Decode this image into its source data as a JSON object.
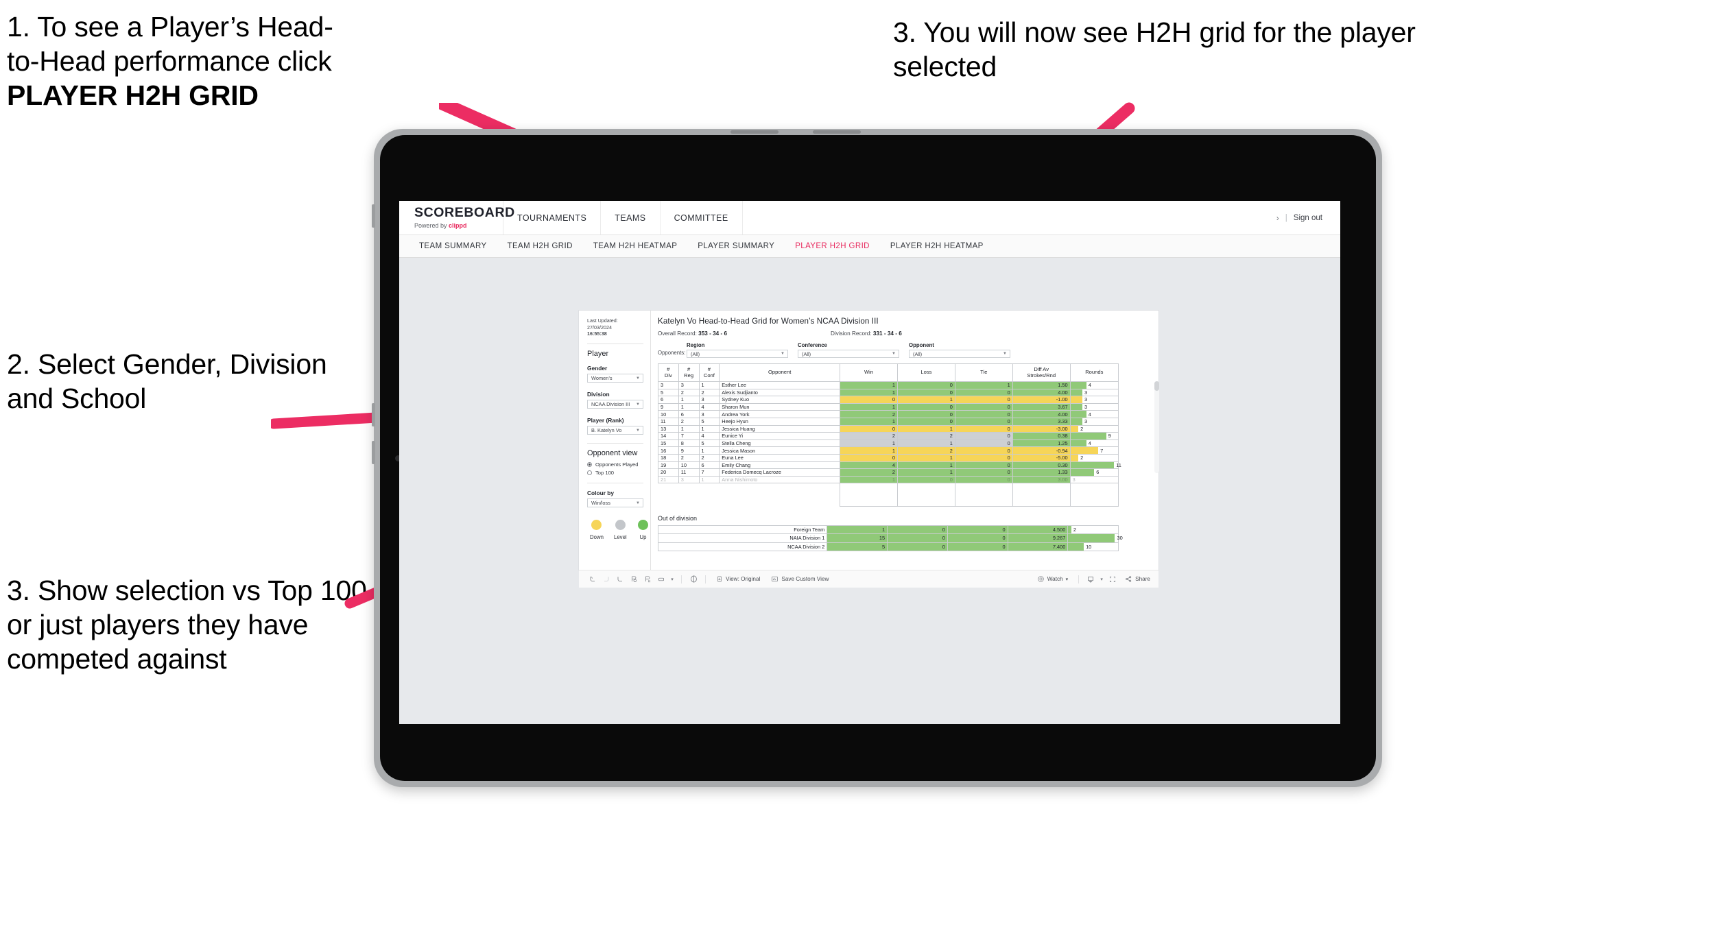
{
  "annotations": [
    {
      "id": "annot-1",
      "line1": "1. To see a Player’s Head-",
      "line2": "to-Head performance click",
      "bold": "PLAYER H2H GRID"
    },
    {
      "id": "annot-2",
      "text": "2. Select Gender, Division and School"
    },
    {
      "id": "annot-3",
      "text": "3. Show selection vs Top 100 or just players they have competed against"
    },
    {
      "id": "annot-4",
      "text": "3. You will now see H2H grid for the player selected"
    }
  ],
  "app": {
    "brand": {
      "title": "SCOREBOARD",
      "powered_prefix": "Powered by ",
      "powered_brand": "clippd"
    },
    "top_nav": [
      "TOURNAMENTS",
      "TEAMS",
      "COMMITTEE"
    ],
    "account": {
      "chevron": "›",
      "separator": "|",
      "sign_out": "Sign out"
    },
    "sub_nav": [
      {
        "label": "TEAM SUMMARY",
        "active": false
      },
      {
        "label": "TEAM H2H GRID",
        "active": false
      },
      {
        "label": "TEAM H2H HEATMAP",
        "active": false
      },
      {
        "label": "PLAYER SUMMARY",
        "active": false
      },
      {
        "label": "PLAYER H2H GRID",
        "active": true
      },
      {
        "label": "PLAYER H2H HEATMAP",
        "active": false
      }
    ],
    "accent_color": "#e8285d"
  },
  "panel": {
    "last_updated_label": "Last Updated: 27/03/2024",
    "last_updated_time": "16:55:38",
    "section_player": "Player",
    "gender": {
      "label": "Gender",
      "value": "Women’s"
    },
    "division": {
      "label": "Division",
      "value": "NCAA Division III"
    },
    "player_rank": {
      "label": "Player (Rank)",
      "value": "B. Katelyn Vo"
    },
    "opponent_view": {
      "label": "Opponent view",
      "options": [
        {
          "label": "Opponents Played",
          "selected": true
        },
        {
          "label": "Top 100",
          "selected": false
        }
      ]
    },
    "colour_by": {
      "label": "Colour by",
      "value": "Win/loss"
    },
    "legend": [
      {
        "label": "Down",
        "color": "#f6d558"
      },
      {
        "label": "Level",
        "color": "#c3c6ca"
      },
      {
        "label": "Up",
        "color": "#6ec15a"
      }
    ]
  },
  "main": {
    "title": "Katelyn Vo Head-to-Head Grid for Women’s NCAA Division III",
    "overall_record_label": "Overall Record:",
    "overall_record_value": "353 -  34 - 6",
    "division_record_label": "Division Record:",
    "division_record_value": "331 -  34 - 6",
    "opponents_label": "Opponents:",
    "filters": [
      {
        "label": "Region",
        "value": "(All)"
      },
      {
        "label": "Conference",
        "value": "(All)"
      },
      {
        "label": "Opponent",
        "value": "(All)"
      }
    ],
    "table_headers": [
      "#\nDiv",
      "#\nReg",
      "#\nConf",
      "Opponent",
      "Win",
      "Loss",
      "Tie",
      "Diff Av\nStrokes/Rnd",
      "Rounds"
    ],
    "header_div_l1": "#",
    "header_div_l2": "Div",
    "header_reg_l1": "#",
    "header_reg_l2": "Reg",
    "header_conf_l1": "#",
    "header_conf_l2": "Conf",
    "header_opponent": "Opponent",
    "header_win": "Win",
    "header_loss": "Loss",
    "header_tie": "Tie",
    "header_diff_l1": "Diff Av",
    "header_diff_l2": "Strokes/Rnd",
    "header_rounds": "Rounds",
    "out_of_division_title": "Out of division"
  },
  "chart_data": {
    "type": "table",
    "title": "Katelyn Vo Head-to-Head Grid for Women’s NCAA Division III",
    "columns": [
      "# Div",
      "# Reg",
      "# Conf",
      "Opponent",
      "Win",
      "Loss",
      "Tie",
      "Diff Av Strokes/Rnd",
      "Rounds"
    ],
    "rows": [
      {
        "div": "3",
        "reg": "3",
        "conf": "1",
        "opponent": "Esther Lee",
        "win": "1",
        "loss": "0",
        "tie": "1",
        "diff": "1.50",
        "rounds": "4",
        "state": "up"
      },
      {
        "div": "5",
        "reg": "2",
        "conf": "2",
        "opponent": "Alexis Sudjianto",
        "win": "1",
        "loss": "0",
        "tie": "0",
        "diff": "4.00",
        "rounds": "3",
        "state": "up"
      },
      {
        "div": "6",
        "reg": "1",
        "conf": "3",
        "opponent": "Sydney Kuo",
        "win": "0",
        "loss": "1",
        "tie": "0",
        "diff": "-1.00",
        "rounds": "3",
        "state": "down"
      },
      {
        "div": "9",
        "reg": "1",
        "conf": "4",
        "opponent": "Sharon Mun",
        "win": "1",
        "loss": "0",
        "tie": "0",
        "diff": "3.67",
        "rounds": "3",
        "state": "up"
      },
      {
        "div": "10",
        "reg": "6",
        "conf": "3",
        "opponent": "Andrea York",
        "win": "2",
        "loss": "0",
        "tie": "0",
        "diff": "4.00",
        "rounds": "4",
        "state": "up"
      },
      {
        "div": "11",
        "reg": "2",
        "conf": "5",
        "opponent": "Heejo Hyun",
        "win": "1",
        "loss": "0",
        "tie": "0",
        "diff": "3.33",
        "rounds": "3",
        "state": "up"
      },
      {
        "div": "13",
        "reg": "1",
        "conf": "1",
        "opponent": "Jessica Huang",
        "win": "0",
        "loss": "1",
        "tie": "0",
        "diff": "-3.00",
        "rounds": "2",
        "state": "down"
      },
      {
        "div": "14",
        "reg": "7",
        "conf": "4",
        "opponent": "Eunice Yi",
        "win": "2",
        "loss": "2",
        "tie": "0",
        "diff": "0.38",
        "rounds": "9",
        "state": "level",
        "diff_state": "up"
      },
      {
        "div": "15",
        "reg": "8",
        "conf": "5",
        "opponent": "Stella Cheng",
        "win": "1",
        "loss": "1",
        "tie": "0",
        "diff": "1.25",
        "rounds": "4",
        "state": "level",
        "diff_state": "up"
      },
      {
        "div": "16",
        "reg": "9",
        "conf": "1",
        "opponent": "Jessica Mason",
        "win": "1",
        "loss": "2",
        "tie": "0",
        "diff": "-0.94",
        "rounds": "7",
        "state": "down"
      },
      {
        "div": "18",
        "reg": "2",
        "conf": "2",
        "opponent": "Euna Lee",
        "win": "0",
        "loss": "1",
        "tie": "0",
        "diff": "-5.00",
        "rounds": "2",
        "state": "down"
      },
      {
        "div": "19",
        "reg": "10",
        "conf": "6",
        "opponent": "Emily Chang",
        "win": "4",
        "loss": "1",
        "tie": "0",
        "diff": "0.30",
        "rounds": "11",
        "state": "up"
      },
      {
        "div": "20",
        "reg": "11",
        "conf": "7",
        "opponent": "Federica Domecq Lacroze",
        "win": "2",
        "loss": "1",
        "tie": "0",
        "diff": "1.33",
        "rounds": "6",
        "state": "up"
      }
    ],
    "out_of_division": [
      {
        "name": "Foreign Team",
        "win": "1",
        "loss": "0",
        "tie": "0",
        "diff": "4.500",
        "rounds": "2",
        "state": "up"
      },
      {
        "name": "NAIA Division 1",
        "win": "15",
        "loss": "0",
        "tie": "0",
        "diff": "9.267",
        "rounds": "30",
        "state": "up"
      },
      {
        "name": "NCAA Division 2",
        "win": "5",
        "loss": "0",
        "tie": "0",
        "diff": "7.400",
        "rounds": "10",
        "state": "up"
      }
    ],
    "colors": {
      "up": "#90c978",
      "down": "#f6d558",
      "level": "#cdd0d4"
    }
  },
  "toolbar": {
    "view_label": "View: Original",
    "save_label": "Save Custom View",
    "watch_label": "Watch",
    "share_label": "Share",
    "caret": "▾"
  }
}
